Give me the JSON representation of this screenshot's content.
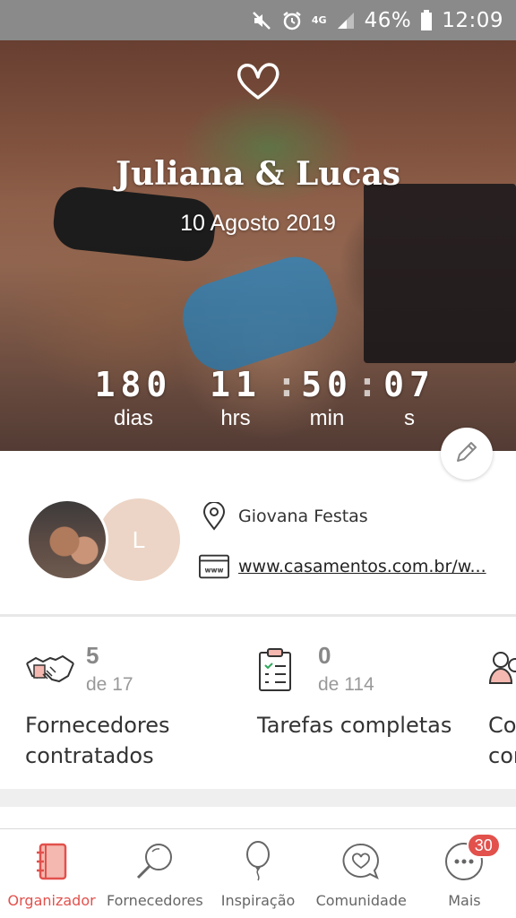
{
  "status_bar": {
    "icons": [
      "mute-icon",
      "alarm-icon",
      "4g-icon",
      "signal-icon",
      "battery-icon"
    ],
    "network": "4G",
    "battery": "46%",
    "time": "12:09"
  },
  "hero": {
    "icon": "heart-outline-icon",
    "names": "Juliana & Lucas",
    "date": "10 Agosto 2019",
    "countdown": [
      {
        "value": "180",
        "label": "dias"
      },
      {
        "value": "11",
        "label": "hrs"
      },
      {
        "value": "50",
        "label": "min"
      },
      {
        "value": "07",
        "label": "s"
      }
    ],
    "edit_icon": "pencil-icon"
  },
  "profile": {
    "avatar_letter": "L",
    "venue": "Giovana Festas",
    "website": "www.casamentos.com.br/w..."
  },
  "stats": [
    {
      "icon": "handshake-icon",
      "count": "5",
      "total": "de 17",
      "title": "Fornecedores contratados"
    },
    {
      "icon": "checklist-icon",
      "count": "0",
      "total": "de 114",
      "title": "Tarefas completas"
    },
    {
      "icon": "guests-icon",
      "count": "",
      "total": "",
      "title": "Co con"
    }
  ],
  "nav": {
    "items": [
      {
        "label": "Organizador",
        "icon": "planner-icon",
        "active": true
      },
      {
        "label": "Fornecedores",
        "icon": "search-icon",
        "active": false
      },
      {
        "label": "Inspiração",
        "icon": "balloon-icon",
        "active": false
      },
      {
        "label": "Comunidade",
        "icon": "chat-heart-icon",
        "active": false
      },
      {
        "label": "Mais",
        "icon": "more-icon",
        "active": false
      }
    ],
    "more_badge": "30"
  },
  "colors": {
    "accent": "#e2514c",
    "avatar_bg": "#ecd5c6",
    "status_bar": "#8a8a8a"
  }
}
